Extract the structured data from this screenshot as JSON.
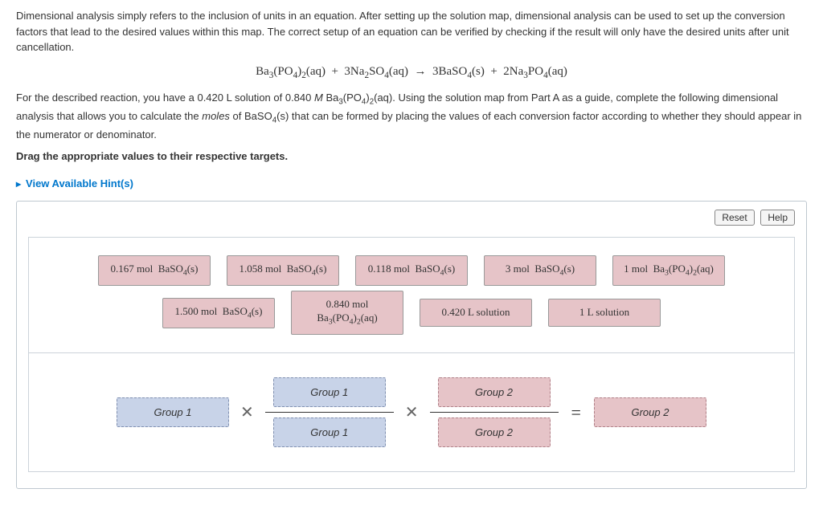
{
  "intro": "Dimensional analysis simply refers to the inclusion of units in an equation. After setting up the solution map, dimensional analysis can be used to set up the conversion factors that lead to the desired values within this map. The correct setup of an equation can be verified by checking if the result will only have the desired units after unit cancellation.",
  "equation_html": "Ba<sub>3</sub>(PO<sub>4</sub>)<sub>2</sub>(aq) &nbsp;+&nbsp; 3Na<sub>2</sub>SO<sub>4</sub>(aq) &nbsp;→&nbsp; 3BaSO<sub>4</sub>(s) &nbsp;+&nbsp; 2Na<sub>3</sub>PO<sub>4</sub>(aq)",
  "problem_html": "For the described reaction, you have a 0.420 L solution of 0.840 <i>M</i> Ba<sub>3</sub>(PO<sub>4</sub>)<sub>2</sub>(aq). Using the solution map from Part A as a guide, complete the following dimensional analysis that allows you to calculate the <i>moles</i> of BaSO<sub>4</sub>(s) that can be formed by placing the values of each conversion factor according to whether they should appear in the numerator or denominator.",
  "drag_instruction": "Drag the appropriate values to their respective targets.",
  "hints_label": "View Available Hint(s)",
  "buttons": {
    "reset": "Reset",
    "help": "Help"
  },
  "drag_items": {
    "row1": [
      {
        "html": "0.167 mol &nbsp;BaSO<sub>4</sub>(s)"
      },
      {
        "html": "1.058 mol &nbsp;BaSO<sub>4</sub>(s)"
      },
      {
        "html": "0.118 mol &nbsp;BaSO<sub>4</sub>(s)"
      },
      {
        "html": "3 mol &nbsp;BaSO<sub>4</sub>(s)"
      },
      {
        "html": "1 mol &nbsp;Ba<sub>3</sub>(PO<sub>4</sub>)<sub>2</sub>(aq)"
      }
    ],
    "row2": [
      {
        "html": "1.500 mol &nbsp;BaSO<sub>4</sub>(s)"
      },
      {
        "html": "0.840 mol<br>Ba<sub>3</sub>(PO<sub>4</sub>)<sub>2</sub>(aq)"
      },
      {
        "html": "0.420 L solution"
      },
      {
        "html": "1 L solution"
      }
    ]
  },
  "targets": {
    "start": "Group 1",
    "frac1_top": "Group 1",
    "frac1_bot": "Group 1",
    "frac2_top": "Group 2",
    "frac2_bot": "Group 2",
    "result": "Group 2"
  },
  "ops": {
    "times": "✕",
    "equals": "="
  }
}
